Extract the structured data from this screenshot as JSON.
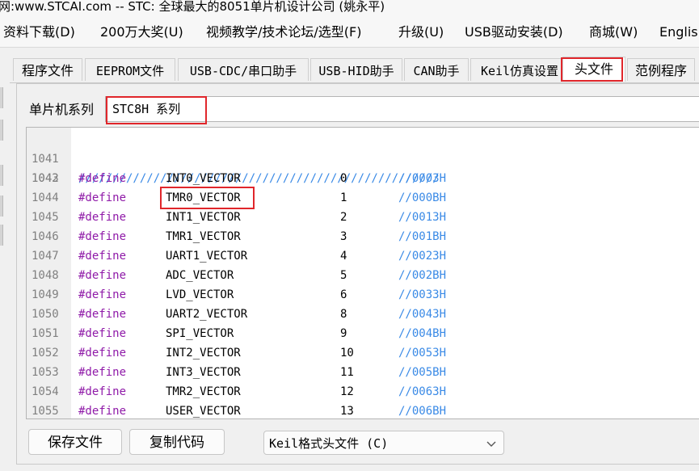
{
  "title": "网:www.STCAI.com  -- STC: 全球最大的8051单片机设计公司 (姚永平)",
  "menu": [
    "资料下载(D)",
    "200万大奖(U)",
    "视频教学/技术论坛/选型(F)",
    "升级(U)",
    "USB驱动安装(D)",
    "商城(W)",
    "English"
  ],
  "tabs": [
    "程序文件",
    "EEPROM文件",
    "USB-CDC/串口助手",
    "USB-HID助手",
    "CAN助手",
    "Keil仿真设置",
    "头文件",
    "范例程序"
  ],
  "active_tab": "头文件",
  "series": {
    "label": "单片机系列",
    "value": "STC8H 系列"
  },
  "code": {
    "separator_line": {
      "num": "1041",
      "text": "/////////////////////////////////////////////////////"
    },
    "blank_line": {
      "num": "1042"
    },
    "defines": [
      {
        "num": "1043",
        "kw": "#define",
        "name": "INT0_VECTOR",
        "value": "0",
        "comment": "//0003H"
      },
      {
        "num": "1044",
        "kw": "#define",
        "name": "TMR0_VECTOR",
        "value": "1",
        "comment": "//000BH"
      },
      {
        "num": "1045",
        "kw": "#define",
        "name": "INT1_VECTOR",
        "value": "2",
        "comment": "//0013H"
      },
      {
        "num": "1046",
        "kw": "#define",
        "name": "TMR1_VECTOR",
        "value": "3",
        "comment": "//001BH"
      },
      {
        "num": "1047",
        "kw": "#define",
        "name": "UART1_VECTOR",
        "value": "4",
        "comment": "//0023H"
      },
      {
        "num": "1048",
        "kw": "#define",
        "name": "ADC_VECTOR",
        "value": "5",
        "comment": "//002BH"
      },
      {
        "num": "1049",
        "kw": "#define",
        "name": "LVD_VECTOR",
        "value": "6",
        "comment": "//0033H"
      },
      {
        "num": "1050",
        "kw": "#define",
        "name": "UART2_VECTOR",
        "value": "8",
        "comment": "//0043H"
      },
      {
        "num": "1051",
        "kw": "#define",
        "name": "SPI_VECTOR",
        "value": "9",
        "comment": "//004BH"
      },
      {
        "num": "1052",
        "kw": "#define",
        "name": "INT2_VECTOR",
        "value": "10",
        "comment": "//0053H"
      },
      {
        "num": "1053",
        "kw": "#define",
        "name": "INT3_VECTOR",
        "value": "11",
        "comment": "//005BH"
      },
      {
        "num": "1054",
        "kw": "#define",
        "name": "TMR2_VECTOR",
        "value": "12",
        "comment": "//0063H"
      },
      {
        "num": "1055",
        "kw": "#define",
        "name": "USER_VECTOR",
        "value": "13",
        "comment": "//006BH"
      }
    ]
  },
  "buttons": {
    "save": "保存文件",
    "copy": "复制代码"
  },
  "format_select": {
    "value": "Keil格式头文件 (C)"
  },
  "colors": {
    "keyword": "#8f1aa8",
    "comment": "#3a8ae6",
    "highlight": "#e0262b"
  }
}
